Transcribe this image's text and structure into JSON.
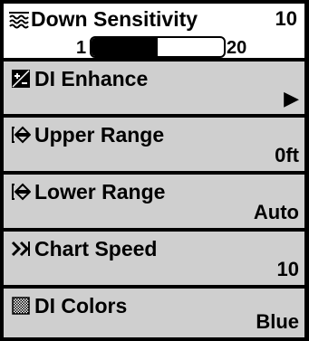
{
  "menu": {
    "selected": {
      "label": "Down Sensitivity",
      "icon": "waves-icon",
      "value": "10",
      "slider": {
        "min": "1",
        "max": "20",
        "level": 0.5
      }
    },
    "items": [
      {
        "label": "DI Enhance",
        "icon": "contrast-icon",
        "value": "▶"
      },
      {
        "label": "Upper Range",
        "icon": "range-arrows-icon",
        "value": "0ft"
      },
      {
        "label": "Lower Range",
        "icon": "range-arrows-icon",
        "value": "Auto"
      },
      {
        "label": "Chart Speed",
        "icon": "fast-forward-icon",
        "value": "10"
      },
      {
        "label": "DI Colors",
        "icon": "palette-icon",
        "value": "Blue"
      }
    ]
  },
  "colors": {
    "selected_bg": "#ffffff",
    "item_bg": "#cfcfcf",
    "frame": "#000000"
  }
}
